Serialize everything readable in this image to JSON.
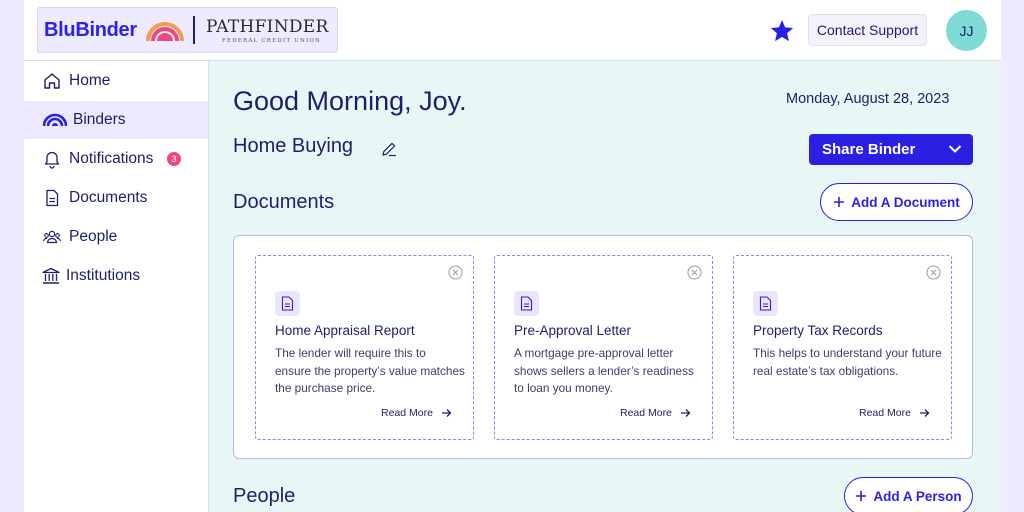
{
  "brand": {
    "app_name": "BluBinder",
    "partner_name": "PATHFINDER",
    "partner_subtitle": "FEDERAL CREDIT UNION"
  },
  "header": {
    "support_label": "Contact Support",
    "avatar_initials": "JJ",
    "star_icon": "star-icon"
  },
  "sidebar": {
    "items": [
      {
        "label": "Home",
        "icon": "home-icon"
      },
      {
        "label": "Binders",
        "icon": "binder-arch-icon",
        "active": true
      },
      {
        "label": "Notifications",
        "icon": "bell-icon",
        "badge": "3"
      },
      {
        "label": "Documents",
        "icon": "document-icon"
      },
      {
        "label": "People",
        "icon": "people-icon"
      },
      {
        "label": "Institutions",
        "icon": "bank-icon"
      }
    ]
  },
  "main": {
    "greeting": "Good Morning, Joy.",
    "date": "Monday, August 28, 2023",
    "binder_title": "Home Buying",
    "share_label": "Share Binder",
    "documents_title": "Documents",
    "add_document_label": "Add A Document",
    "people_title": "People",
    "add_person_label": "Add A Person",
    "documents": [
      {
        "title": "Home Appraisal Report",
        "description": "The lender will require this to ensure the property’s value matches the purchase price.",
        "link": "Read More"
      },
      {
        "title": "Pre-Approval Letter",
        "description": "A mortgage pre-approval letter shows sellers a lender’s readiness to loan you money.",
        "link": "Read More"
      },
      {
        "title": "Property Tax Records",
        "description": "This helps to understand your future real estate’s tax obligations.",
        "link": "Read More"
      }
    ]
  },
  "colors": {
    "primary": "#2b1fe4",
    "navy": "#1c1f6b",
    "content_bg": "#e8f7f6",
    "page_bg": "#efeaff",
    "badge": "#f0487a",
    "avatar": "#7fdad4"
  }
}
